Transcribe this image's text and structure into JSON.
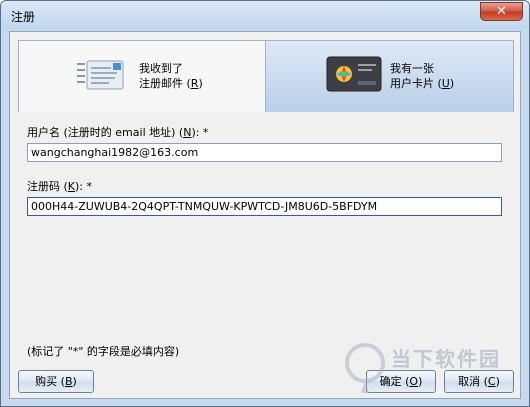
{
  "window": {
    "title": "注册",
    "close_glyph": "✕"
  },
  "cards": {
    "email": {
      "line1": "我收到了",
      "line2_prefix": "注册邮件 (",
      "line2_key": "R",
      "line2_suffix": ")",
      "icon": "mail-document-icon"
    },
    "license": {
      "line1": "我有一张",
      "line2_prefix": "用户卡片 (",
      "line2_key": "U",
      "line2_suffix": ")",
      "icon": "license-card-icon"
    }
  },
  "form": {
    "username_label_prefix": "用户名 (注册时的 email 地址) (",
    "username_label_key": "N",
    "username_label_suffix": "): *",
    "username_value": "wangchanghai1982@163.com",
    "code_label_prefix": "注册码 (",
    "code_label_key": "K",
    "code_label_suffix": "): *",
    "code_value": "000H44-ZUWUB4-2Q4QPT-TNMQUW-KPWTCD-JM8U6D-5BFDYM"
  },
  "note": "(标记了 \"*\" 的字段是必填内容)",
  "buttons": {
    "buy_prefix": "购买 (",
    "buy_key": "B",
    "buy_suffix": ")",
    "ok_prefix": "确定 (",
    "ok_key": "O",
    "ok_suffix": ")",
    "cancel_prefix": "取消 (",
    "cancel_key": "C",
    "cancel_suffix": ")"
  },
  "watermark": {
    "text": "当下软件园"
  }
}
